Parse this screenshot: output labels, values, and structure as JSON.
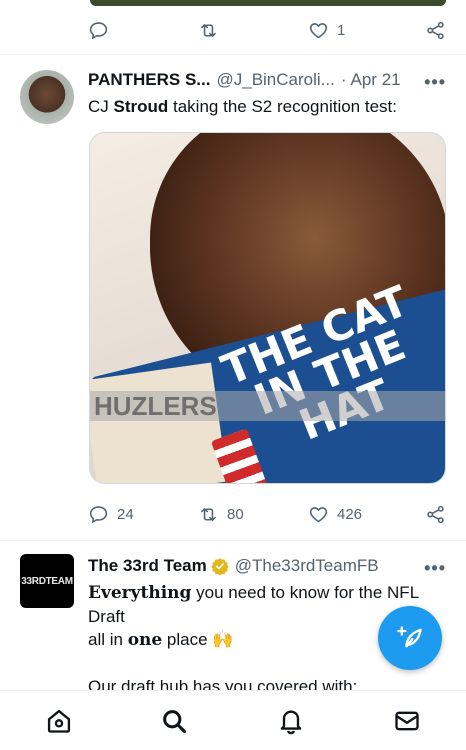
{
  "previous_tweet": {
    "actions": {
      "reply_count": "",
      "retweet_count": "",
      "like_count": "1"
    }
  },
  "tweet1": {
    "display_name": "PANTHERS S...",
    "handle": "@J_BinCaroli...",
    "separator": "·",
    "date": "Apr 21",
    "more": "•••",
    "text_before": "CJ ",
    "text_bold": "Stroud",
    "text_after": " taking the S2 recognition test:",
    "media": {
      "book_title": "THE CAT IN THE HAT",
      "watermark": "HUZLERS"
    },
    "actions": {
      "reply_count": "24",
      "retweet_count": "80",
      "like_count": "426"
    }
  },
  "tweet2": {
    "display_name": "The 33rd Team",
    "verified": true,
    "handle": "@The33rdTeamFB",
    "more": "•••",
    "avatar_text": "33RDTEAM",
    "line1_bold": "Everything",
    "line1_rest": " you need to know for the NFL Draft",
    "line2_pre": "all in ",
    "line2_bold": "one",
    "line2_post": " place 🙌",
    "line3": "Our draft hub has you covered with:"
  },
  "colors": {
    "accent": "#1d9bf0",
    "secondary_text": "#536471",
    "verified_gold": "#e2b719"
  },
  "icons": {
    "reply": "reply-icon",
    "retweet": "retweet-icon",
    "like": "heart-icon",
    "share": "share-icon",
    "compose": "compose-icon",
    "home": "home-icon",
    "search": "search-icon",
    "notifications": "bell-icon",
    "messages": "envelope-icon"
  }
}
